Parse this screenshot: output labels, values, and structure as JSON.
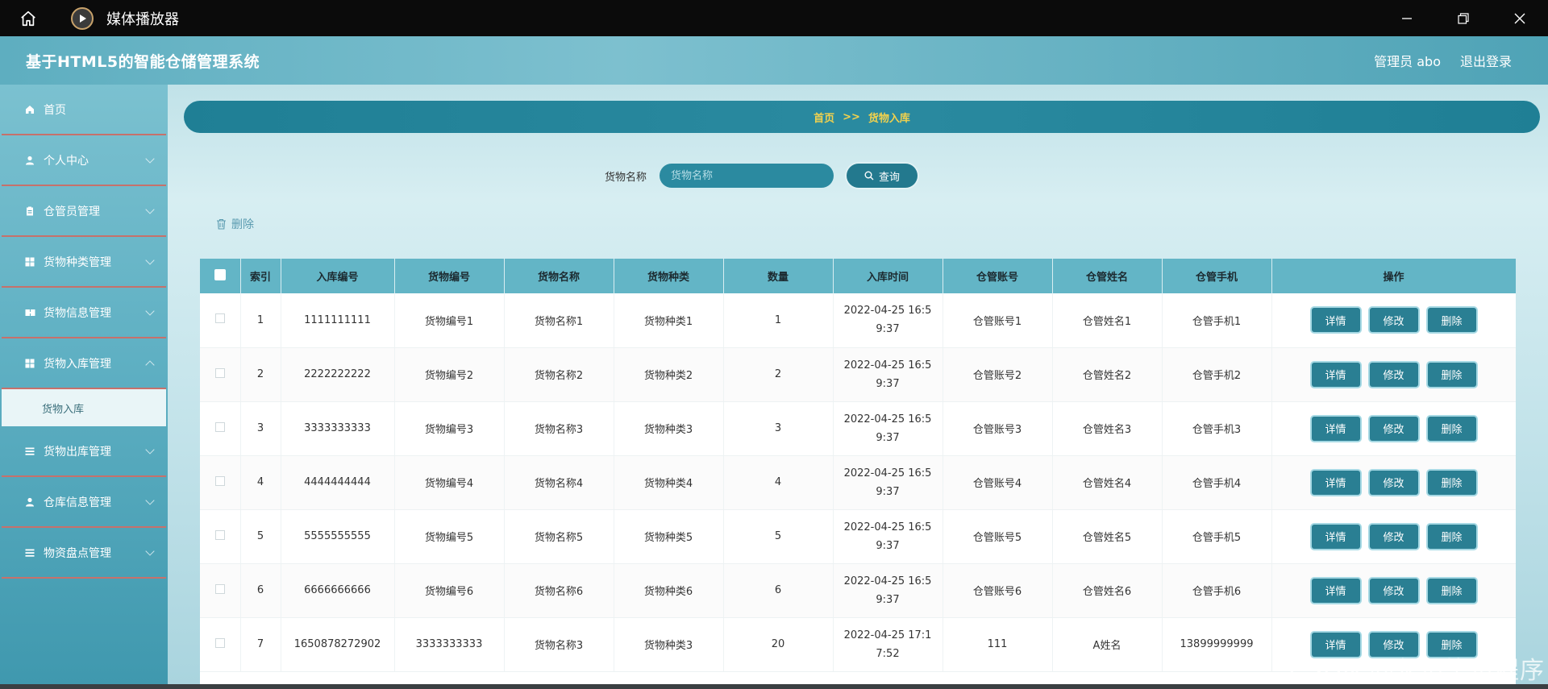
{
  "window": {
    "title": "媒体播放器"
  },
  "app": {
    "title": "基于HTML5的智能仓储管理系统",
    "user_label": "管理员 abo",
    "logout_label": "退出登录"
  },
  "sidebar": {
    "items": [
      {
        "label": "首页",
        "icon": "home-icon"
      },
      {
        "label": "个人中心",
        "icon": "user-icon"
      },
      {
        "label": "仓管员管理",
        "icon": "clipboard-icon"
      },
      {
        "label": "货物种类管理",
        "icon": "grid-icon"
      },
      {
        "label": "货物信息管理",
        "icon": "cards-icon"
      },
      {
        "label": "货物入库管理",
        "icon": "grid-icon"
      }
    ],
    "submenu_label": "货物入库",
    "items_after": [
      {
        "label": "货物出库管理",
        "icon": "list-icon"
      },
      {
        "label": "仓库信息管理",
        "icon": "user-icon"
      },
      {
        "label": "物资盘点管理",
        "icon": "list-icon"
      }
    ]
  },
  "breadcrumb": {
    "home": "首页",
    "sep": ">>",
    "current": "货物入库"
  },
  "search": {
    "label": "货物名称",
    "placeholder": "货物名称",
    "button_label": "查询"
  },
  "bulk_delete_label": "删除",
  "table": {
    "columns": [
      "索引",
      "入库编号",
      "货物编号",
      "货物名称",
      "货物种类",
      "数量",
      "入库时间",
      "仓管账号",
      "仓管姓名",
      "仓管手机",
      "操作"
    ],
    "rows": [
      {
        "index": "1",
        "in_no": "1111111111",
        "goods_no": "货物编号1",
        "goods_name": "货物名称1",
        "goods_type": "货物种类1",
        "qty": "1",
        "time_line1": "2022-04-25 16:5",
        "time_line2": "9:37",
        "account": "仓管账号1",
        "name": "仓管姓名1",
        "phone": "仓管手机1"
      },
      {
        "index": "2",
        "in_no": "2222222222",
        "goods_no": "货物编号2",
        "goods_name": "货物名称2",
        "goods_type": "货物种类2",
        "qty": "2",
        "time_line1": "2022-04-25 16:5",
        "time_line2": "9:37",
        "account": "仓管账号2",
        "name": "仓管姓名2",
        "phone": "仓管手机2"
      },
      {
        "index": "3",
        "in_no": "3333333333",
        "goods_no": "货物编号3",
        "goods_name": "货物名称3",
        "goods_type": "货物种类3",
        "qty": "3",
        "time_line1": "2022-04-25 16:5",
        "time_line2": "9:37",
        "account": "仓管账号3",
        "name": "仓管姓名3",
        "phone": "仓管手机3"
      },
      {
        "index": "4",
        "in_no": "4444444444",
        "goods_no": "货物编号4",
        "goods_name": "货物名称4",
        "goods_type": "货物种类4",
        "qty": "4",
        "time_line1": "2022-04-25 16:5",
        "time_line2": "9:37",
        "account": "仓管账号4",
        "name": "仓管姓名4",
        "phone": "仓管手机4"
      },
      {
        "index": "5",
        "in_no": "5555555555",
        "goods_no": "货物编号5",
        "goods_name": "货物名称5",
        "goods_type": "货物种类5",
        "qty": "5",
        "time_line1": "2022-04-25 16:5",
        "time_line2": "9:37",
        "account": "仓管账号5",
        "name": "仓管姓名5",
        "phone": "仓管手机5"
      },
      {
        "index": "6",
        "in_no": "6666666666",
        "goods_no": "货物编号6",
        "goods_name": "货物名称6",
        "goods_type": "货物种类6",
        "qty": "6",
        "time_line1": "2022-04-25 16:5",
        "time_line2": "9:37",
        "account": "仓管账号6",
        "name": "仓管姓名6",
        "phone": "仓管手机6"
      },
      {
        "index": "7",
        "in_no": "1650878272902",
        "goods_no": "3333333333",
        "goods_name": "货物名称3",
        "goods_type": "货物种类3",
        "qty": "20",
        "time_line1": "2022-04-25 17:1",
        "time_line2": "7:52",
        "account": "111",
        "name": "A姓名",
        "phone": "13899999999"
      }
    ],
    "ops": {
      "detail": "详情",
      "edit": "修改",
      "delete": "删除"
    }
  },
  "watermark": "CSDN @永恒毕设程序",
  "colors": {
    "accent": "#2a7f93",
    "breadcrumb_text": "#f3d24d",
    "header_bg": "#63b5c6"
  }
}
